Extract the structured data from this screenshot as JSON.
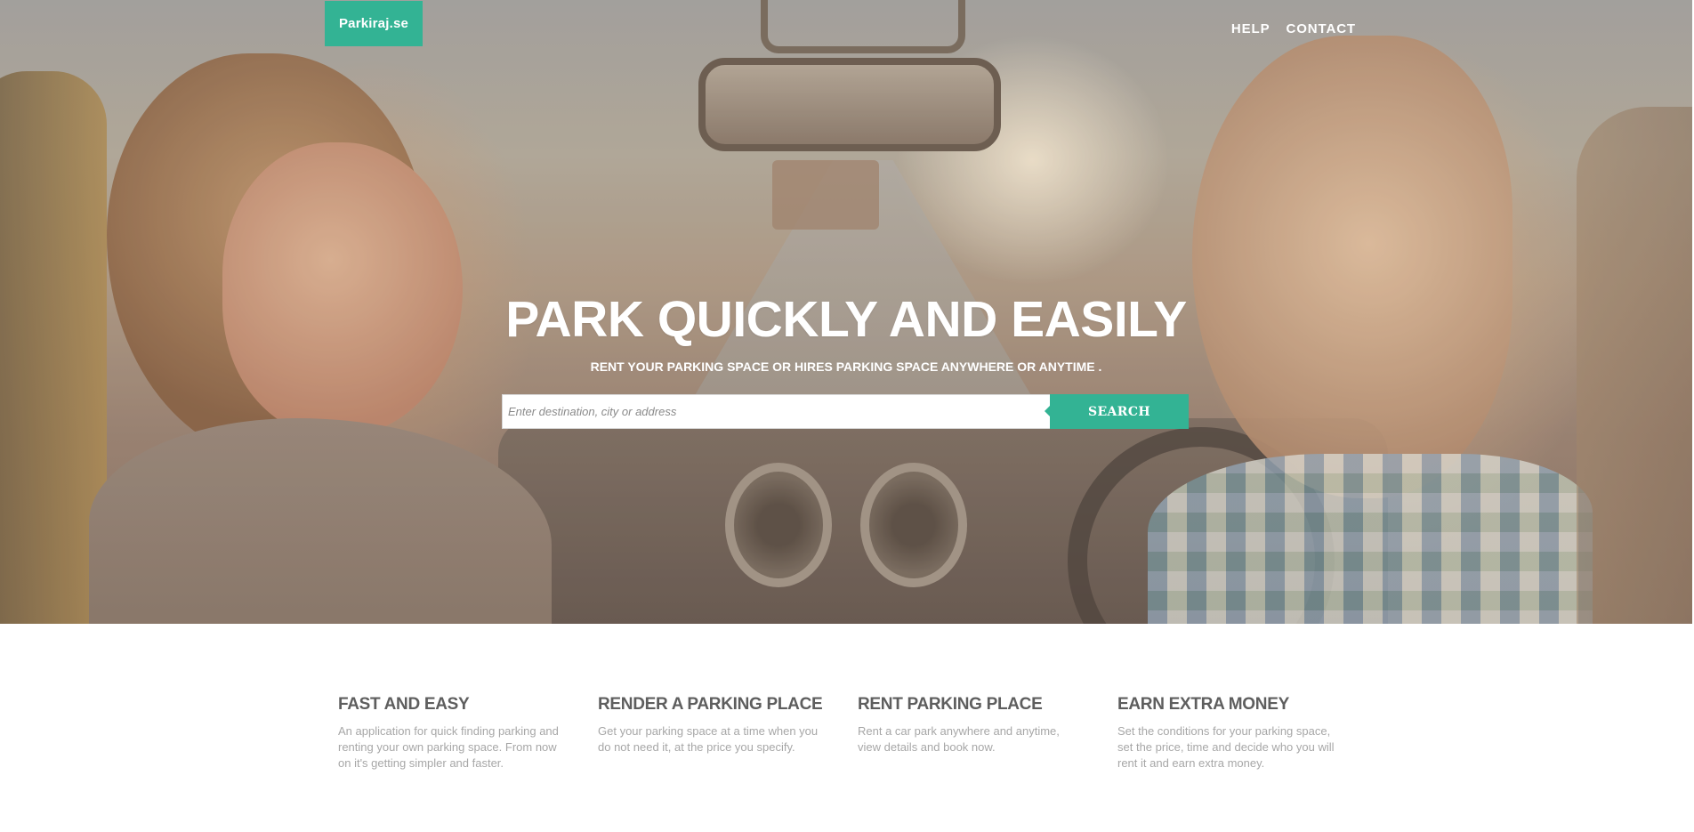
{
  "brand": {
    "logo_text": "Parkiraj.se",
    "accent_color": "#33b394"
  },
  "nav": {
    "items": [
      {
        "label": "HELP"
      },
      {
        "label": "CONTACT"
      }
    ]
  },
  "hero": {
    "title": "PARK QUICKLY AND EASILY",
    "subtitle": "RENT YOUR PARKING SPACE OR HIRES PARKING SPACE ANYWHERE OR ANYTIME .",
    "search": {
      "placeholder": "Enter destination, city or address",
      "value": "",
      "button_label": "SEARCH"
    }
  },
  "features": [
    {
      "title": "FAST AND EASY",
      "text": "An application for quick finding parking and renting your own parking space. From now on it's getting simpler and faster."
    },
    {
      "title": "RENDER A PARKING PLACE",
      "text": "Get your parking space at a time when you do not need it, at the price you specify."
    },
    {
      "title": "RENT PARKING PLACE",
      "text": "Rent a car park anywhere and anytime, view details and book now."
    },
    {
      "title": "EARN EXTRA MONEY",
      "text": "Set the conditions for your parking space, set the price, time and decide who you will rent it and earn extra money."
    }
  ]
}
